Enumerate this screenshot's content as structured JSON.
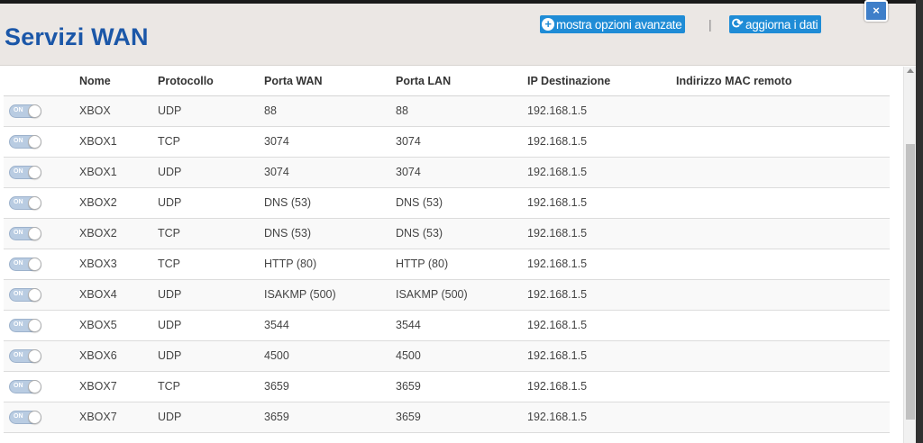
{
  "header": {
    "title": "Servizi WAN",
    "advanced_label": "mostra opzioni avanzate",
    "refresh_label": "aggiorna i dati",
    "separator": "|",
    "close_label": "×"
  },
  "table": {
    "columns": [
      "",
      "Nome",
      "Protocollo",
      "Porta WAN",
      "Porta LAN",
      "IP Destinazione",
      "Indirizzo MAC remoto"
    ],
    "rows": [
      {
        "toggle": "ON",
        "name": "XBOX",
        "protocol": "UDP",
        "wan": "88",
        "lan": "88",
        "ip": "192.168.1.5",
        "mac": ""
      },
      {
        "toggle": "ON",
        "name": "XBOX1",
        "protocol": "TCP",
        "wan": "3074",
        "lan": "3074",
        "ip": "192.168.1.5",
        "mac": ""
      },
      {
        "toggle": "ON",
        "name": "XBOX1",
        "protocol": "UDP",
        "wan": "3074",
        "lan": "3074",
        "ip": "192.168.1.5",
        "mac": ""
      },
      {
        "toggle": "ON",
        "name": "XBOX2",
        "protocol": "UDP",
        "wan": "DNS (53)",
        "lan": "DNS (53)",
        "ip": "192.168.1.5",
        "mac": ""
      },
      {
        "toggle": "ON",
        "name": "XBOX2",
        "protocol": "TCP",
        "wan": "DNS (53)",
        "lan": "DNS (53)",
        "ip": "192.168.1.5",
        "mac": ""
      },
      {
        "toggle": "ON",
        "name": "XBOX3",
        "protocol": "TCP",
        "wan": "HTTP (80)",
        "lan": "HTTP (80)",
        "ip": "192.168.1.5",
        "mac": ""
      },
      {
        "toggle": "ON",
        "name": "XBOX4",
        "protocol": "UDP",
        "wan": "ISAKMP (500)",
        "lan": "ISAKMP (500)",
        "ip": "192.168.1.5",
        "mac": ""
      },
      {
        "toggle": "ON",
        "name": "XBOX5",
        "protocol": "UDP",
        "wan": "3544",
        "lan": "3544",
        "ip": "192.168.1.5",
        "mac": ""
      },
      {
        "toggle": "ON",
        "name": "XBOX6",
        "protocol": "UDP",
        "wan": "4500",
        "lan": "4500",
        "ip": "192.168.1.5",
        "mac": ""
      },
      {
        "toggle": "ON",
        "name": "XBOX7",
        "protocol": "TCP",
        "wan": "3659",
        "lan": "3659",
        "ip": "192.168.1.5",
        "mac": ""
      },
      {
        "toggle": "ON",
        "name": "XBOX7",
        "protocol": "UDP",
        "wan": "3659",
        "lan": "3659",
        "ip": "192.168.1.5",
        "mac": ""
      }
    ]
  },
  "colors": {
    "title": "#1b57a8",
    "button": "#1f8cd6",
    "header_bg": "#ebe7e4",
    "toggle_on": "#b9cce2"
  },
  "icons": {
    "advanced": "plus-circle-icon",
    "refresh": "refresh-icon",
    "close": "close-icon"
  }
}
